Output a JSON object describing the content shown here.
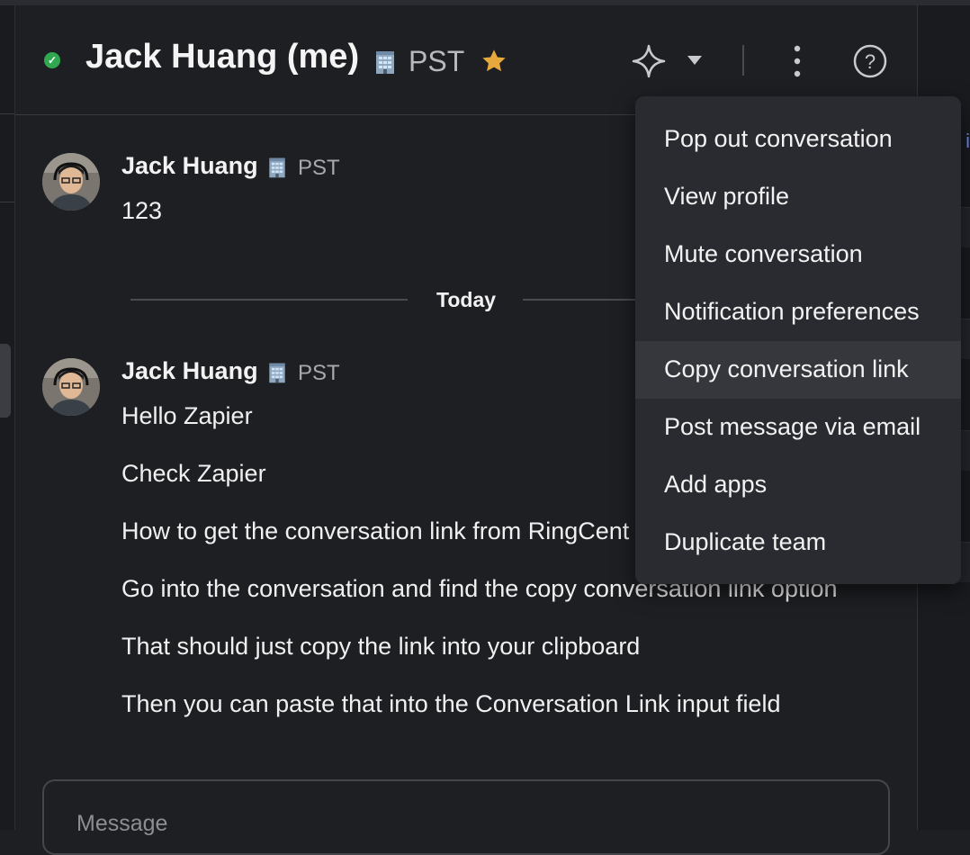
{
  "header": {
    "title": "Jack Huang (me)",
    "timezone": "PST",
    "status": "online",
    "icons": {
      "presence": "check-circle-icon",
      "building": "building-icon",
      "favorite": "star-icon",
      "ai": "sparkle-icon",
      "dropdown": "chevron-down-icon",
      "more": "more-vertical-icon",
      "help": "help-circle-icon"
    },
    "colors": {
      "presence": "#2fa84f",
      "star": "#e8a93c",
      "accent": "#6a8dff"
    }
  },
  "messages": [
    {
      "author": "Jack Huang",
      "timezone": "PST",
      "lines": [
        "123"
      ]
    },
    {
      "author": "Jack Huang",
      "timezone": "PST",
      "lines": [
        "Hello Zapier",
        "Check Zapier",
        "How to get the conversation link from RingCent",
        "Go into the conversation and find the copy conversation link option",
        "That should just copy the link into your clipboard",
        "Then you can paste that into the Conversation Link input field"
      ]
    }
  ],
  "divider": {
    "label": "Today"
  },
  "composer": {
    "placeholder": "Message"
  },
  "menu": {
    "highlighted": "Copy conversation link",
    "items": [
      "Pop out conversation",
      "View profile",
      "Mute conversation",
      "Notification preferences",
      "Copy conversation link",
      "Post message via email",
      "Add apps",
      "Duplicate team"
    ]
  }
}
